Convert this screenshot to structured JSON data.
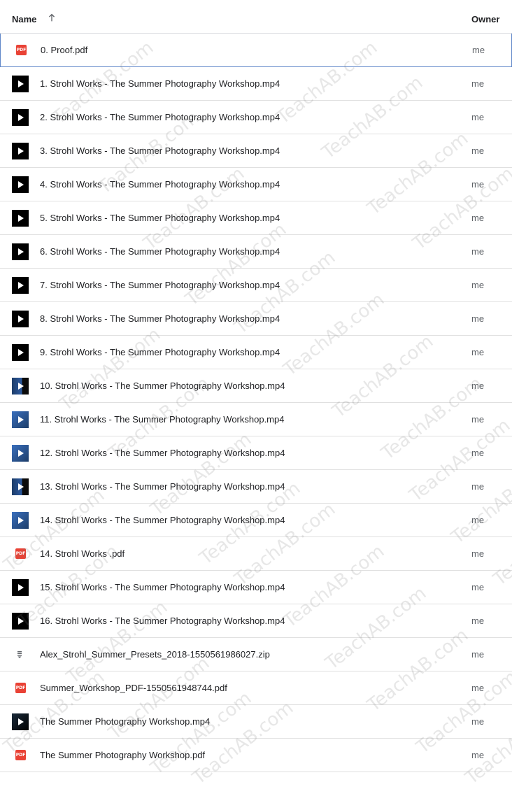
{
  "header": {
    "name_label": "Name",
    "owner_label": "Owner",
    "sort_icon": "arrow-upward-icon"
  },
  "files": [
    {
      "name": "0. Proof.pdf",
      "owner": "me",
      "type": "pdf",
      "selected": true
    },
    {
      "name": "1. Strohl Works - The Summer Photography Workshop.mp4",
      "owner": "me",
      "type": "video"
    },
    {
      "name": "2. Strohl Works - The Summer Photography Workshop.mp4",
      "owner": "me",
      "type": "video"
    },
    {
      "name": "3. Strohl Works - The Summer Photography Workshop.mp4",
      "owner": "me",
      "type": "video"
    },
    {
      "name": "4. Strohl Works - The Summer Photography Workshop.mp4",
      "owner": "me",
      "type": "video"
    },
    {
      "name": "5. Strohl Works - The Summer Photography Workshop.mp4",
      "owner": "me",
      "type": "video"
    },
    {
      "name": "6. Strohl Works - The Summer Photography Workshop.mp4",
      "owner": "me",
      "type": "video"
    },
    {
      "name": "7. Strohl Works - The Summer Photography Workshop.mp4",
      "owner": "me",
      "type": "video"
    },
    {
      "name": "8. Strohl Works - The Summer Photography Workshop.mp4",
      "owner": "me",
      "type": "video"
    },
    {
      "name": "9. Strohl Works - The Summer Photography Workshop.mp4",
      "owner": "me",
      "type": "video"
    },
    {
      "name": "10. Strohl Works - The Summer Photography Workshop.mp4",
      "owner": "me",
      "type": "video-blue"
    },
    {
      "name": "11. Strohl Works - The Summer Photography Workshop.mp4",
      "owner": "me",
      "type": "video-blue2"
    },
    {
      "name": "12. Strohl Works - The Summer Photography Workshop.mp4",
      "owner": "me",
      "type": "video-blue2"
    },
    {
      "name": "13. Strohl Works - The Summer Photography Workshop.mp4",
      "owner": "me",
      "type": "video-blue"
    },
    {
      "name": "14. Strohl Works - The Summer Photography Workshop.mp4",
      "owner": "me",
      "type": "video-blue2"
    },
    {
      "name": "14. Strohl Works .pdf",
      "owner": "me",
      "type": "pdf"
    },
    {
      "name": "15. Strohl Works - The Summer Photography Workshop.mp4",
      "owner": "me",
      "type": "video"
    },
    {
      "name": "16. Strohl Works - The Summer Photography Workshop.mp4",
      "owner": "me",
      "type": "video"
    },
    {
      "name": "Alex_Strohl_Summer_Presets_2018-1550561986027.zip",
      "owner": "me",
      "type": "zip"
    },
    {
      "name": "Summer_Workshop_PDF-1550561948744.pdf",
      "owner": "me",
      "type": "pdf"
    },
    {
      "name": "The Summer Photography Workshop.mp4",
      "owner": "me",
      "type": "video-dark2"
    },
    {
      "name": "The Summer Photography Workshop.pdf",
      "owner": "me",
      "type": "pdf"
    }
  ],
  "icons": {
    "pdf_label": "PDF"
  },
  "watermark_text": "TeachAB.com",
  "colors": {
    "pdf_red": "#e94235",
    "selection_border": "#5f86c9",
    "divider": "#e0e0e0"
  }
}
